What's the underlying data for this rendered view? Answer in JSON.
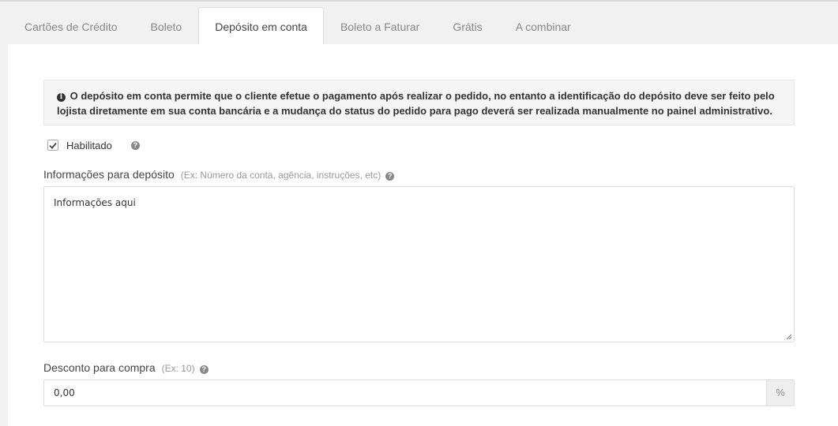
{
  "tabs": [
    {
      "label": "Cartões de Crédito"
    },
    {
      "label": "Boleto"
    },
    {
      "label": "Depósito em conta",
      "active": true
    },
    {
      "label": "Boleto a Faturar"
    },
    {
      "label": "Grátis"
    },
    {
      "label": "A combinar"
    }
  ],
  "alert": {
    "icon": "info-circle-icon",
    "text": "O depósito em conta permite que o cliente efetue o pagamento após realizar o pedido, no entanto a identificação do depósito deve ser feito pelo lojista diretamente em sua conta bancária e a mudança do status do pedido para pago deverá ser realizada manualmente no painel administrativo."
  },
  "enabled": {
    "label": "Habilitado",
    "checked": true,
    "help_icon": "question-circle-icon"
  },
  "deposit_info": {
    "label": "Informações para depósito",
    "hint": "(Ex: Número da conta, agência, instruções, etc)",
    "value": "Informações aqui"
  },
  "discount": {
    "label": "Desconto para compra",
    "hint": "(Ex: 10)",
    "value": "0,00",
    "unit": "%"
  },
  "colors": {
    "background": "#f1f1f1",
    "panel": "#ffffff",
    "alert_bg": "#f5f5f5",
    "text": "#333333",
    "muted": "#999999"
  }
}
